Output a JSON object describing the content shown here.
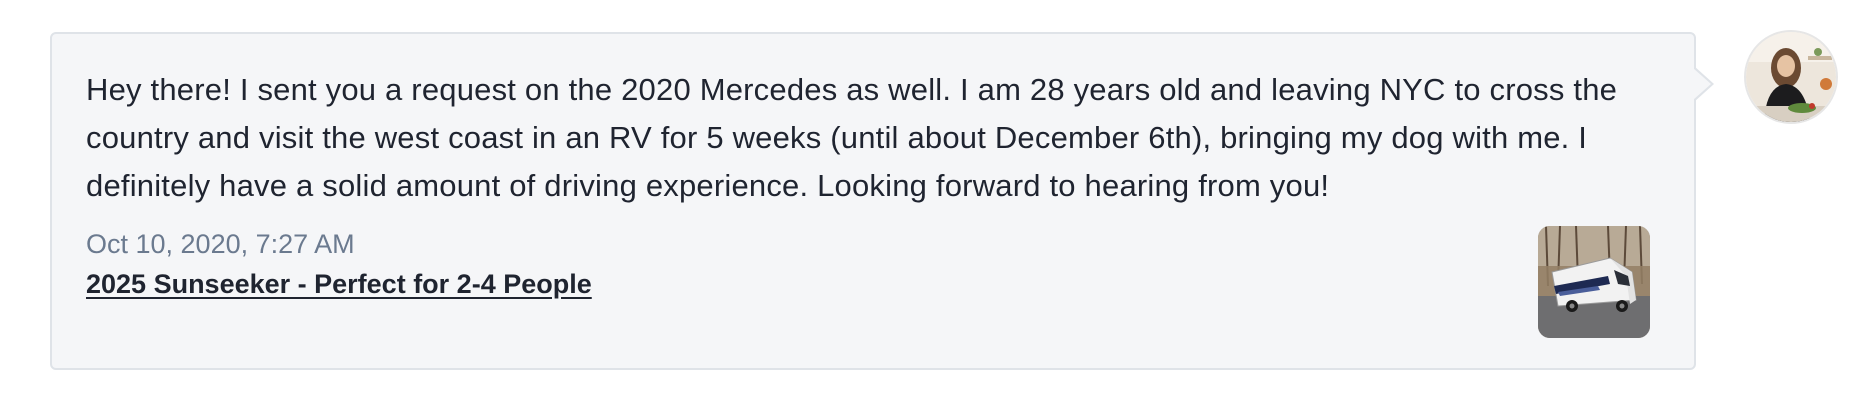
{
  "message": {
    "text": "Hey there! I sent you a request on the 2020 Mercedes as well. I am 28 years old and leaving NYC to cross the country and visit the west coast in an RV for 5 weeks (until about December 6th), bringing my dog with me. I definitely have a solid amount of driving experience. Looking forward to hearing from you!",
    "timestamp": "Oct 10, 2020, 7:27 AM",
    "listing_title": "2025 Sunseeker - Perfect for 2-4 People"
  },
  "listing_thumbnail": {
    "icon": "rv-photo"
  },
  "sender": {
    "icon": "user-avatar-photo"
  },
  "colors": {
    "bubble_bg": "#f5f6f8",
    "bubble_border": "#dfe3e8",
    "text": "#1f2430",
    "timestamp": "#6b7a8f"
  }
}
